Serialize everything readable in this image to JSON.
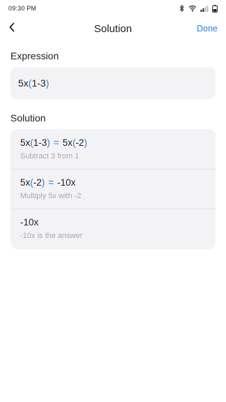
{
  "status_bar": {
    "time": "09:30 PM"
  },
  "nav": {
    "title": "Solution",
    "done_label": "Done"
  },
  "expression": {
    "label": "Expression",
    "prefix": "5x",
    "open_paren": "(",
    "inner": "1-3",
    "close_paren": ")"
  },
  "solution": {
    "label": "Solution",
    "steps": [
      {
        "lhs_prefix": "5x",
        "lhs_open": "(",
        "lhs_inner": "1-3",
        "lhs_close": ")",
        "equals": "=",
        "rhs_prefix": "5x",
        "rhs_open": "(",
        "rhs_inner": "-2",
        "rhs_close": ")",
        "note": "Subtract 3 from 1"
      },
      {
        "lhs_prefix": "5x",
        "lhs_open": "(",
        "lhs_inner": "-2",
        "lhs_close": ")",
        "equals": "=",
        "rhs": "-10x",
        "note": "Multiply 5x with -2"
      },
      {
        "result": "-10x",
        "note": "-10x is the answer"
      }
    ]
  },
  "colors": {
    "accent": "#2d7fd3",
    "card_bg": "#f3f3f5",
    "note_text": "#a9a9ad"
  }
}
